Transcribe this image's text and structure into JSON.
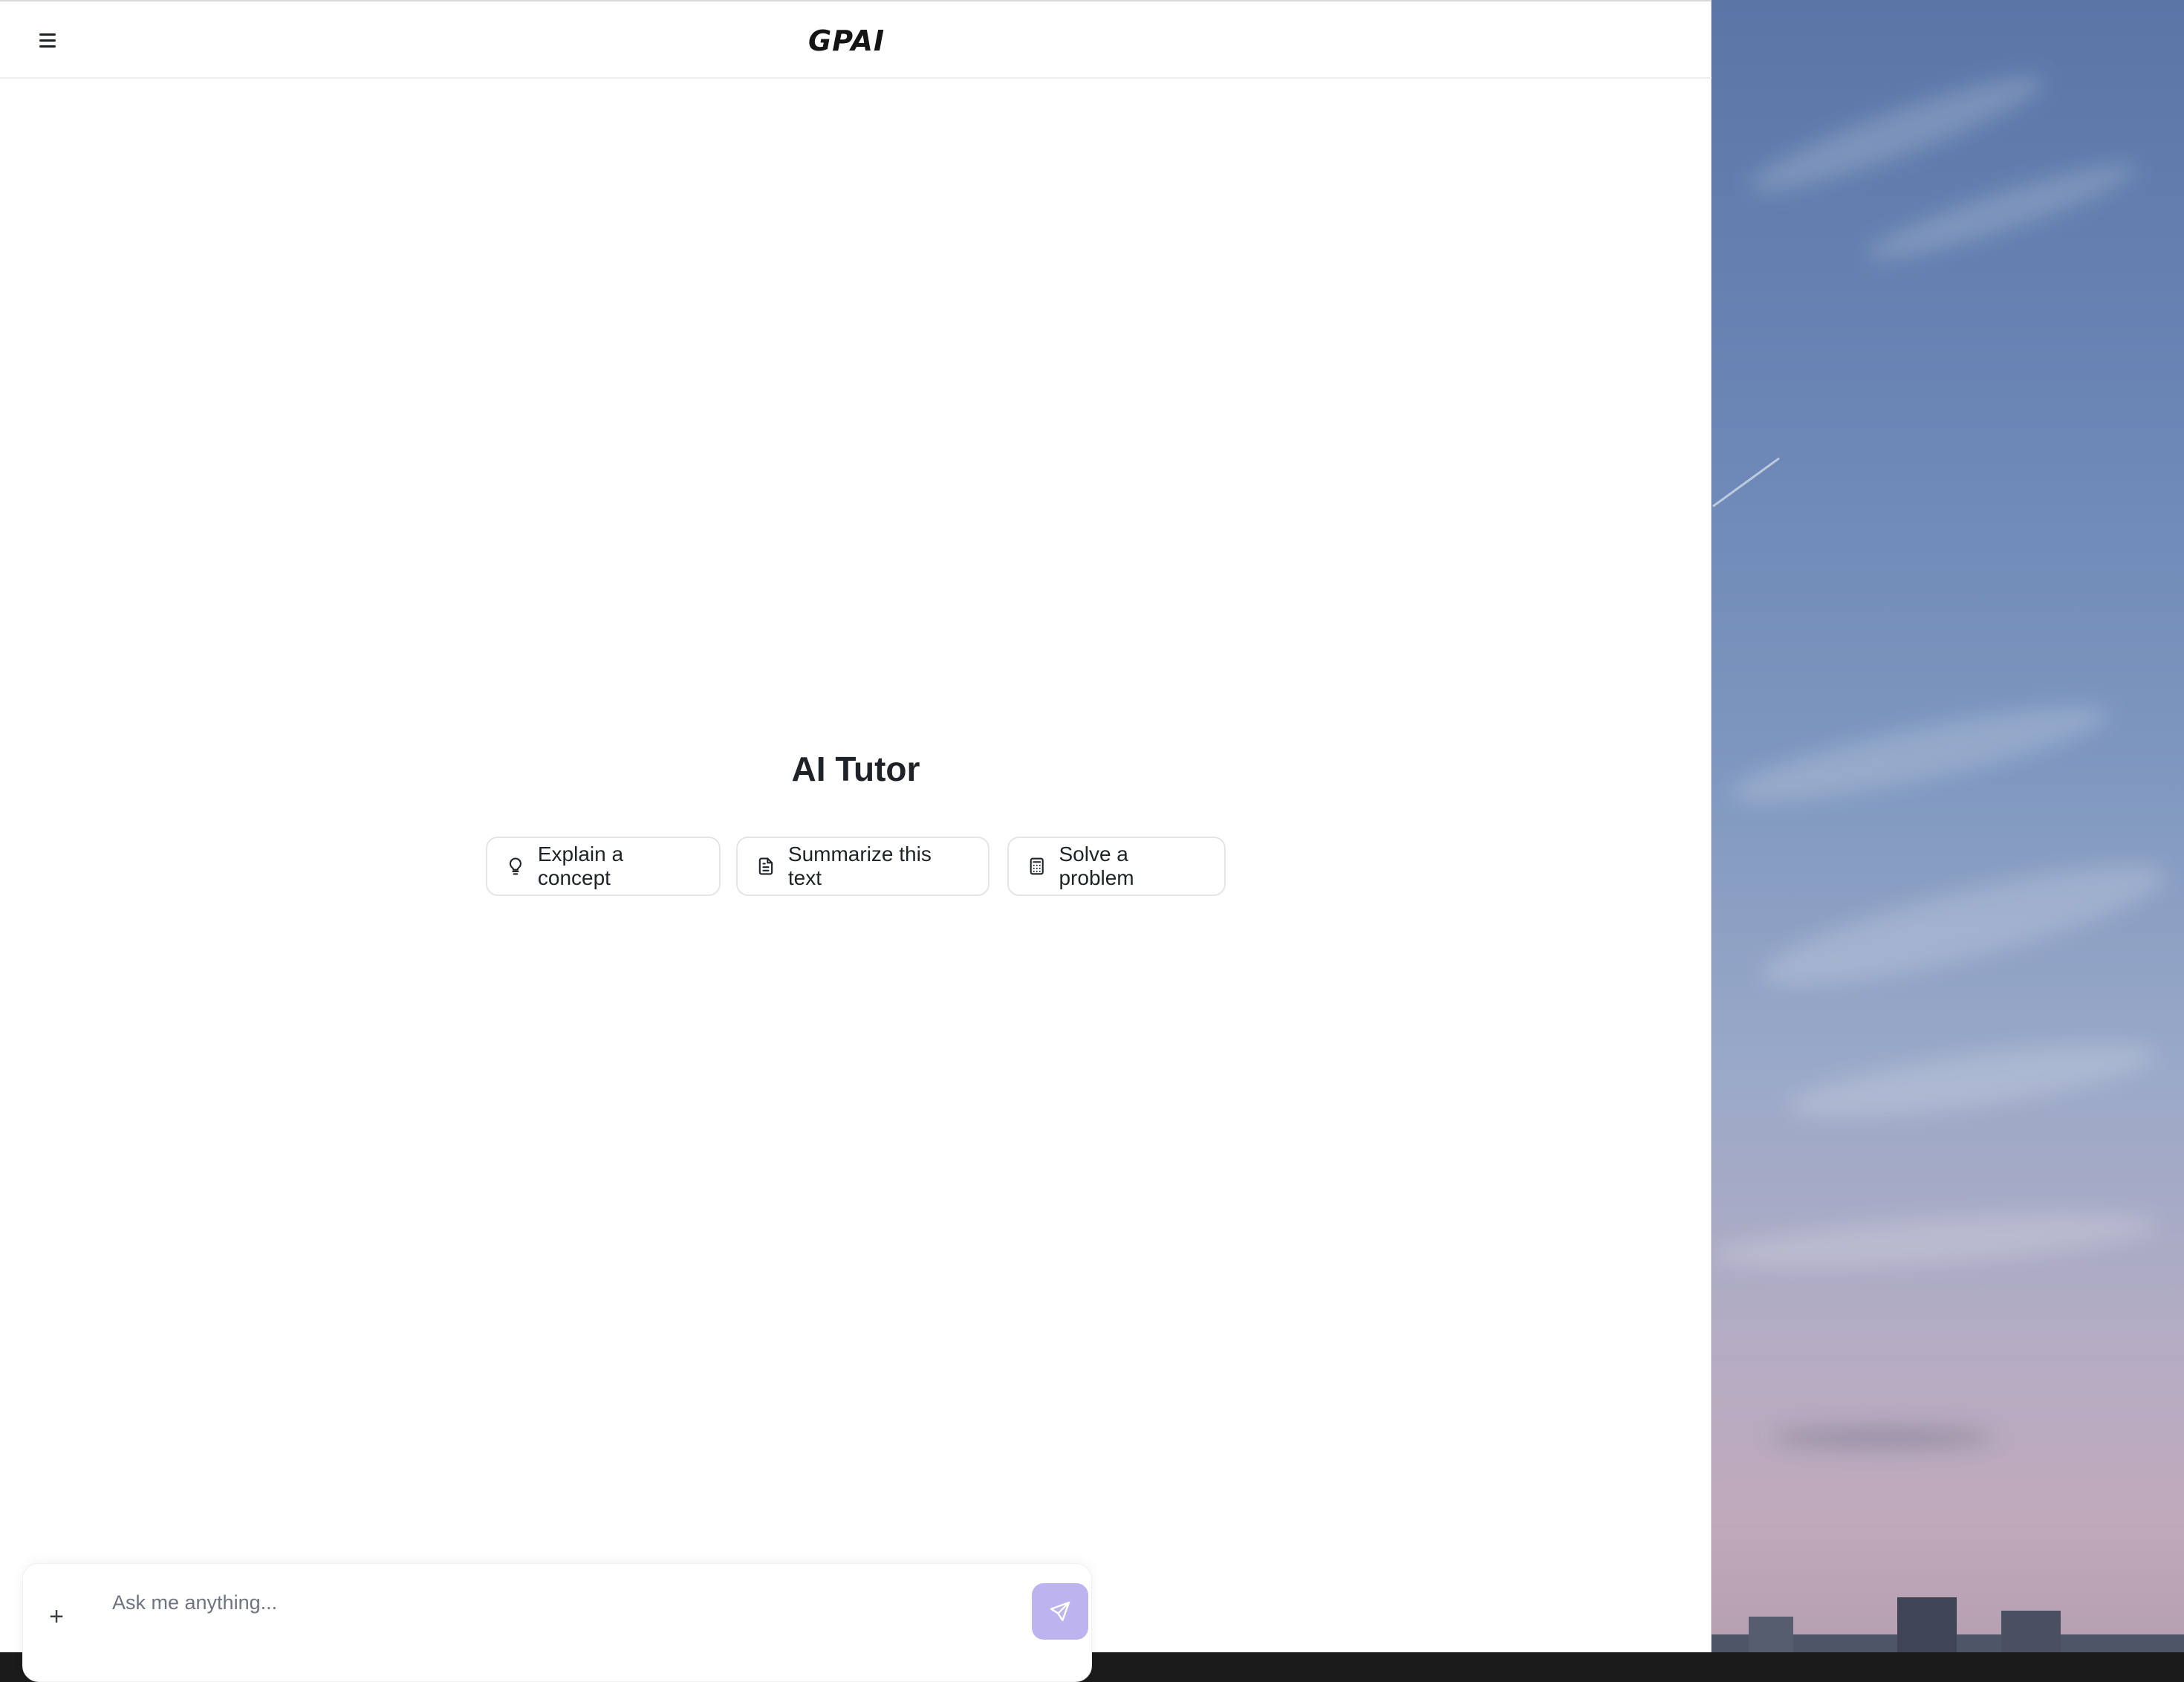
{
  "header": {
    "logo_text": "GPAI",
    "menu_icon": "hamburger-menu-icon"
  },
  "main": {
    "title": "AI Tutor",
    "suggestions": [
      {
        "label": "Explain a concept",
        "icon": "lightbulb-icon"
      },
      {
        "label": "Summarize this text",
        "icon": "document-icon"
      },
      {
        "label": "Solve a problem",
        "icon": "calculator-icon"
      }
    ]
  },
  "composer": {
    "placeholder": "Ask me anything...",
    "attach_icon": "plus-icon",
    "send_icon": "send-icon"
  },
  "colors": {
    "accent": "#bdb3ef",
    "text": "#1f2328",
    "border": "#e3e5e8"
  }
}
